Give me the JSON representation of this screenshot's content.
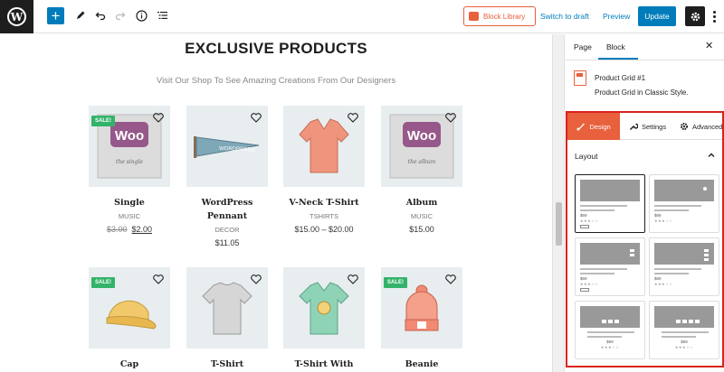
{
  "toolbar": {
    "block_library_label": "Block Library",
    "switch_to_draft_label": "Switch to draft",
    "preview_label": "Preview",
    "update_label": "Update",
    "icons": [
      "wordpress-logo-icon",
      "add-block-icon",
      "edit-pencil-icon",
      "undo-icon",
      "redo-icon",
      "info-icon",
      "list-view-icon",
      "settings-gear-icon",
      "more-options-icon"
    ]
  },
  "canvas": {
    "heading": "EXCLUSIVE PRODUCTS",
    "subheading": "Visit Our Shop To See Amazing Creations From Our Designers",
    "products": [
      {
        "title": "Single",
        "category": "MUSIC",
        "old_price": "$3.00",
        "price": "$2.00",
        "sale": "SALE!",
        "image": "woo-album-icon"
      },
      {
        "title": "WordPress Pennant",
        "category": "DECOR",
        "price": "$11.05",
        "image": "pennant-icon"
      },
      {
        "title": "V-Neck T-Shirt",
        "category": "TSHIRTS",
        "price": "$15.00 – $20.00",
        "image": "vneck-tshirt-icon"
      },
      {
        "title": "Album",
        "category": "MUSIC",
        "price": "$15.00",
        "image": "woo-album-icon"
      },
      {
        "title": "Cap",
        "sale": "SALE!",
        "image": "cap-icon"
      },
      {
        "title": "T-Shirt",
        "image": "tshirt-icon"
      },
      {
        "title": "T-Shirt With Logo",
        "image": "tshirt-logo-icon"
      },
      {
        "title": "Beanie",
        "sale": "SALE!",
        "image": "beanie-icon"
      }
    ]
  },
  "sidebar": {
    "tabs": [
      "Page",
      "Block"
    ],
    "active_tab": "Block",
    "block_title": "Product Grid #1",
    "block_desc": "Product Grid in Classic Style.",
    "panel_tabs": [
      "Design",
      "Settings",
      "Advanced"
    ],
    "active_panel_tab": "Design",
    "section_title": "Layout",
    "layout_option": {
      "price": "$69",
      "stars": "★★★☆☆"
    }
  },
  "colors": {
    "accent": "#007cba",
    "block_library": "#e8603c",
    "sale_badge": "#33b36a",
    "highlight_frame": "#d9231c"
  }
}
